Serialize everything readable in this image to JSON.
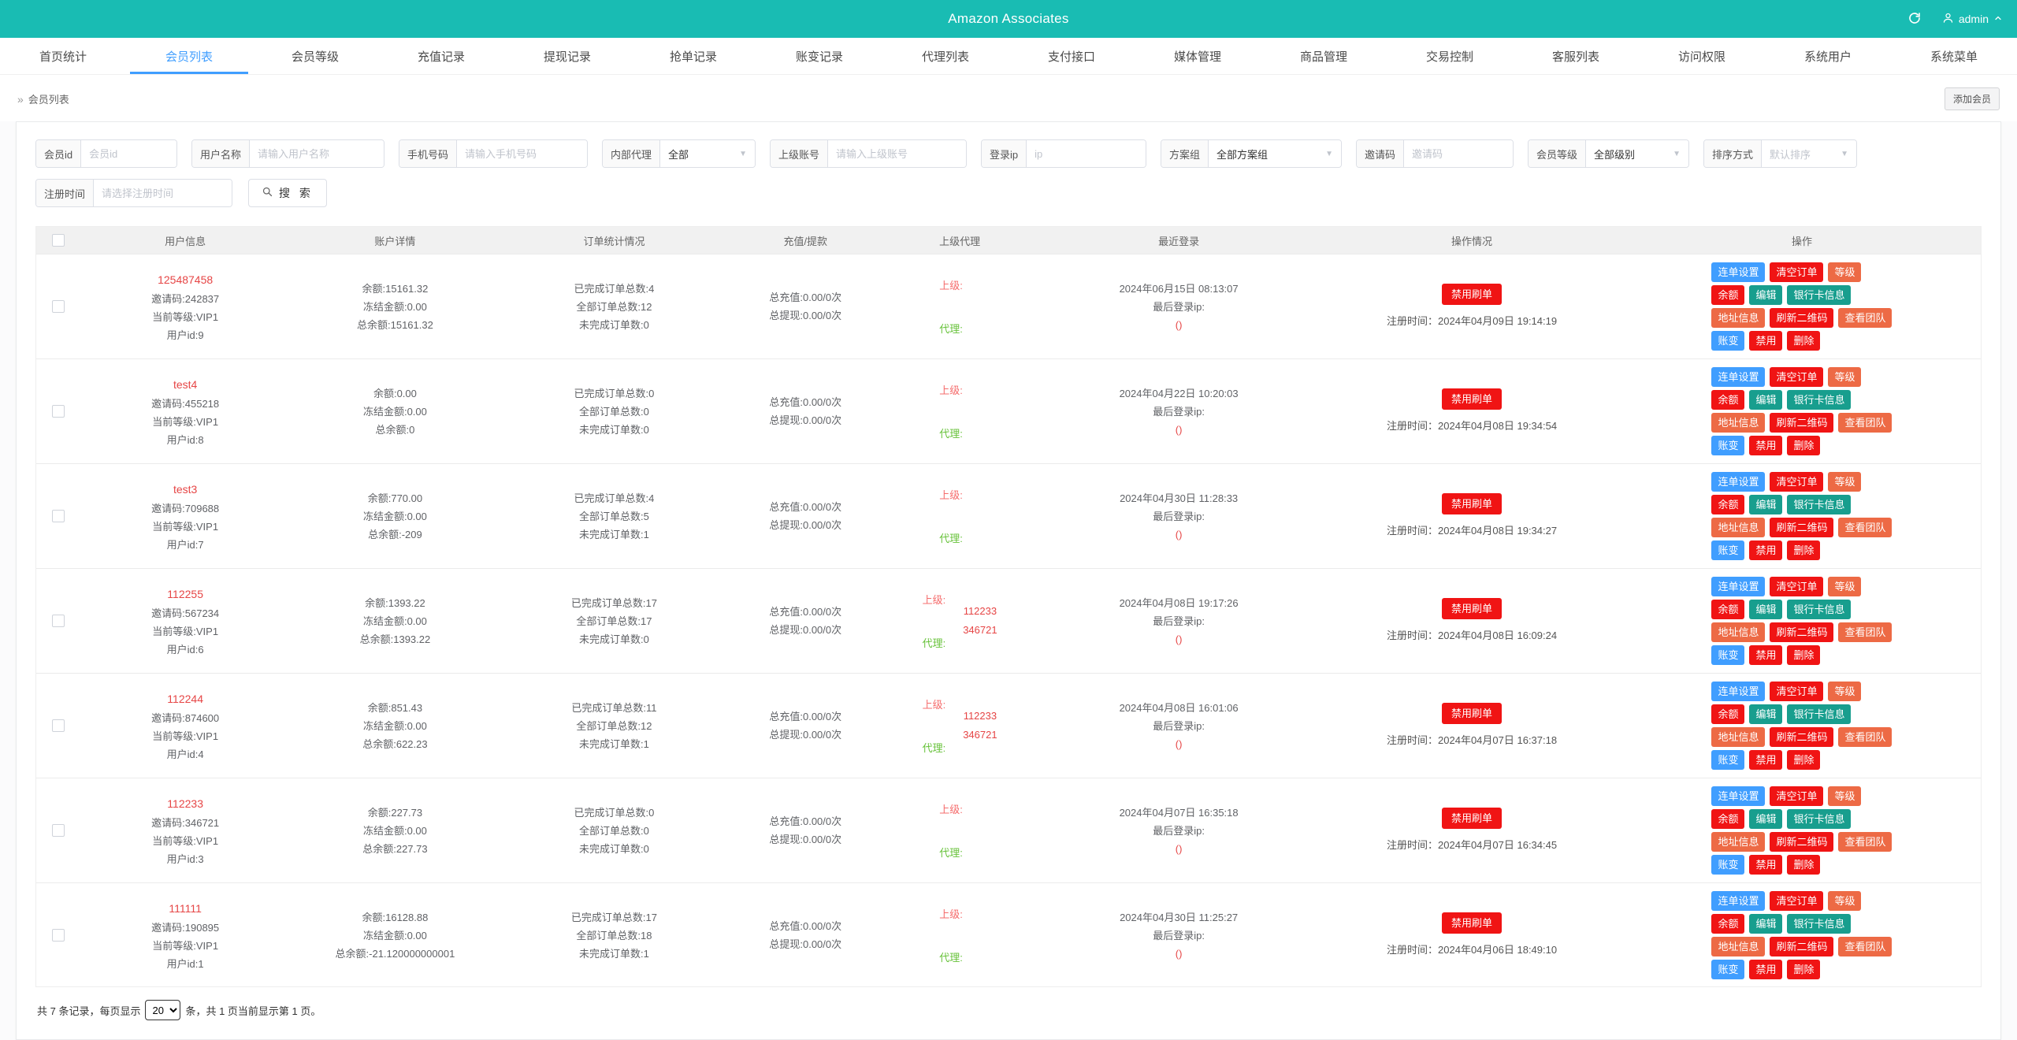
{
  "header": {
    "title": "Amazon Associates",
    "user": "admin"
  },
  "nav": {
    "tabs": [
      {
        "name": "home-stats",
        "label": "首页统计"
      },
      {
        "name": "member-list",
        "label": "会员列表",
        "active": true
      },
      {
        "name": "member-level",
        "label": "会员等级"
      },
      {
        "name": "recharge-records",
        "label": "充值记录"
      },
      {
        "name": "withdraw-records",
        "label": "提现记录"
      },
      {
        "name": "grab-order-records",
        "label": "抢单记录"
      },
      {
        "name": "account-change-records",
        "label": "账变记录"
      },
      {
        "name": "agent-list",
        "label": "代理列表"
      },
      {
        "name": "payment-api",
        "label": "支付接口"
      },
      {
        "name": "media-manage",
        "label": "媒体管理"
      },
      {
        "name": "product-manage",
        "label": "商品管理"
      },
      {
        "name": "trade-control",
        "label": "交易控制"
      },
      {
        "name": "service-list",
        "label": "客服列表"
      },
      {
        "name": "access-control",
        "label": "访问权限"
      },
      {
        "name": "system-users",
        "label": "系统用户"
      },
      {
        "name": "system-menu",
        "label": "系统菜单"
      }
    ]
  },
  "breadcrumb": {
    "arrow": "»",
    "current": "会员列表"
  },
  "add_member_label": "添加会员",
  "filters": [
    {
      "name": "member-id",
      "label": "会员id",
      "type": "input",
      "placeholder": "会员id"
    },
    {
      "name": "username",
      "label": "用户名称",
      "type": "input",
      "placeholder": "请输入用户名称"
    },
    {
      "name": "phone",
      "label": "手机号码",
      "type": "input",
      "placeholder": "请输入手机号码"
    },
    {
      "name": "internal-agent",
      "label": "内部代理",
      "type": "select",
      "value": "全部"
    },
    {
      "name": "parent-account",
      "label": "上级账号",
      "type": "input",
      "placeholder": "请输入上级账号"
    },
    {
      "name": "login-ip",
      "label": "登录ip",
      "type": "input",
      "placeholder": "ip"
    },
    {
      "name": "plan-group",
      "label": "方案组",
      "type": "select",
      "value": "全部方案组"
    },
    {
      "name": "invite-code",
      "label": "邀请码",
      "type": "input",
      "placeholder": "邀请码"
    },
    {
      "name": "member-level",
      "label": "会员等级",
      "type": "select",
      "value": "全部级别"
    },
    {
      "name": "sort-order",
      "label": "排序方式",
      "type": "select",
      "value": "默认排序",
      "muted": true
    }
  ],
  "search_row": {
    "time_label": "注册时间",
    "time_placeholder": "请选择注册时间",
    "search_label": "搜 索"
  },
  "labels": {
    "invite_code": "邀请码:",
    "level": "当前等级:",
    "user_id": "用户id:",
    "balance": "余额:",
    "frozen": "冻结金额:",
    "total_balance": "总余额:",
    "orders_done": "已完成订单总数:",
    "orders_all": "全部订单总数:",
    "orders_undone": "未完成订单数:",
    "recharge": "总充值:",
    "withdraw": "总提现:",
    "parent": "上级:",
    "agent": "代理:",
    "last_login_ip": "最后登录ip:",
    "register_time": "注册时间：",
    "disable_brush": "禁用刷单"
  },
  "actions": [
    {
      "name": "action-chain-order-setup",
      "label": "连单设置",
      "type": "blue"
    },
    {
      "name": "action-clear-orders",
      "label": "清空订单",
      "type": "red"
    },
    {
      "name": "action-level",
      "label": "等级",
      "type": "orange"
    },
    {
      "name": "action-balance",
      "label": "余额",
      "type": "red"
    },
    {
      "name": "action-edit",
      "label": "编辑",
      "type": "teal"
    },
    {
      "name": "action-bank-card-info",
      "label": "银行卡信息",
      "type": "teal"
    },
    {
      "name": "action-address-info",
      "label": "地址信息",
      "type": "orange"
    },
    {
      "name": "action-refresh-qrcode",
      "label": "刷新二维码",
      "type": "red"
    },
    {
      "name": "action-view-team",
      "label": "查看团队",
      "type": "orange"
    },
    {
      "name": "action-account-change",
      "label": "账变",
      "type": "blue"
    },
    {
      "name": "action-disable",
      "label": "禁用",
      "type": "red"
    },
    {
      "name": "action-delete",
      "label": "删除",
      "type": "red"
    }
  ],
  "table": {
    "headers": [
      {
        "name": "user-info",
        "label": "用户信息"
      },
      {
        "name": "account-detail",
        "label": "账户详情"
      },
      {
        "name": "order-stats",
        "label": "订单统计情况"
      },
      {
        "name": "recharge-withdraw",
        "label": "充值/提款"
      },
      {
        "name": "parent-agent",
        "label": "上级代理"
      },
      {
        "name": "last-login",
        "label": "最近登录"
      },
      {
        "name": "operation-status",
        "label": "操作情况"
      },
      {
        "name": "operation",
        "label": "操作"
      }
    ],
    "rows": [
      {
        "username": "125487458",
        "invite_code": "242837",
        "level": "VIP1",
        "user_id": "9",
        "balance": "15161.32",
        "frozen": "0.00",
        "total_balance": "15161.32",
        "orders_done": "4",
        "orders_all": "12",
        "orders_undone": "0",
        "recharge": "0.00/0次",
        "withdraw": "0.00/0次",
        "parents": [],
        "last_login": "2024年06月15日 08:13:07",
        "login_ip_value": "()",
        "register_time": "2024年04月09日 19:14:19"
      },
      {
        "username": "test4",
        "invite_code": "455218",
        "level": "VIP1",
        "user_id": "8",
        "balance": "0.00",
        "frozen": "0.00",
        "total_balance": "0",
        "orders_done": "0",
        "orders_all": "0",
        "orders_undone": "0",
        "recharge": "0.00/0次",
        "withdraw": "0.00/0次",
        "parents": [],
        "last_login": "2024年04月22日 10:20:03",
        "login_ip_value": "()",
        "register_time": "2024年04月08日 19:34:54"
      },
      {
        "username": "test3",
        "invite_code": "709688",
        "level": "VIP1",
        "user_id": "7",
        "balance": "770.00",
        "frozen": "0.00",
        "total_balance": "-209",
        "orders_done": "4",
        "orders_all": "5",
        "orders_undone": "1",
        "recharge": "0.00/0次",
        "withdraw": "0.00/0次",
        "parents": [],
        "last_login": "2024年04月30日 11:28:33",
        "login_ip_value": "()",
        "register_time": "2024年04月08日 19:34:27"
      },
      {
        "username": "112255",
        "invite_code": "567234",
        "level": "VIP1",
        "user_id": "6",
        "balance": "1393.22",
        "frozen": "0.00",
        "total_balance": "1393.22",
        "orders_done": "17",
        "orders_all": "17",
        "orders_undone": "0",
        "recharge": "0.00/0次",
        "withdraw": "0.00/0次",
        "parents": [
          "112233",
          "346721"
        ],
        "last_login": "2024年04月08日 19:17:26",
        "login_ip_value": "()",
        "register_time": "2024年04月08日 16:09:24"
      },
      {
        "username": "112244",
        "invite_code": "874600",
        "level": "VIP1",
        "user_id": "4",
        "balance": "851.43",
        "frozen": "0.00",
        "total_balance": "622.23",
        "orders_done": "11",
        "orders_all": "12",
        "orders_undone": "1",
        "recharge": "0.00/0次",
        "withdraw": "0.00/0次",
        "parents": [
          "112233",
          "346721"
        ],
        "last_login": "2024年04月08日 16:01:06",
        "login_ip_value": "()",
        "register_time": "2024年04月07日 16:37:18"
      },
      {
        "username": "112233",
        "invite_code": "346721",
        "level": "VIP1",
        "user_id": "3",
        "balance": "227.73",
        "frozen": "0.00",
        "total_balance": "227.73",
        "orders_done": "0",
        "orders_all": "0",
        "orders_undone": "0",
        "recharge": "0.00/0次",
        "withdraw": "0.00/0次",
        "parents": [],
        "last_login": "2024年04月07日 16:35:18",
        "login_ip_value": "()",
        "register_time": "2024年04月07日 16:34:45"
      },
      {
        "username": "111111",
        "invite_code": "190895",
        "level": "VIP1",
        "user_id": "1",
        "balance": "16128.88",
        "frozen": "0.00",
        "total_balance": "-21.120000000001",
        "orders_done": "17",
        "orders_all": "18",
        "orders_undone": "1",
        "recharge": "0.00/0次",
        "withdraw": "0.00/0次",
        "parents": [],
        "last_login": "2024年04月30日 11:25:27",
        "login_ip_value": "()",
        "register_time": "2024年04月06日 18:49:10"
      }
    ]
  },
  "pagination": {
    "prefix": "共 7 条记录，每页显示",
    "page_size": "20",
    "suffix": "条，共 1 页当前显示第 1 页。"
  },
  "colors": {
    "header_teal": "#19bcb3",
    "active_tab": "#409eff",
    "red_text": "#e64545",
    "soft_red": "#f56c6c",
    "green_text": "#67c23a",
    "btn_red": "#f01414",
    "btn_orange": "#ed6a45",
    "btn_blue": "#409eff",
    "btn_teal": "#189e8e"
  }
}
